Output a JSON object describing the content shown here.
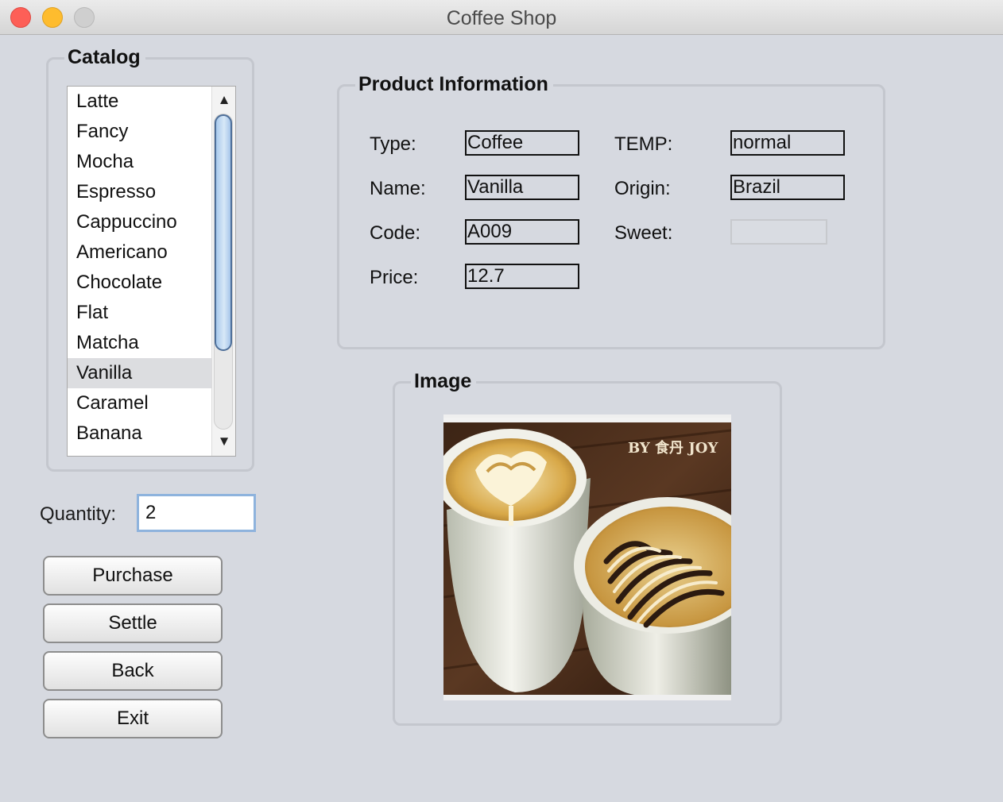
{
  "window": {
    "title": "Coffee Shop"
  },
  "catalog": {
    "title": "Catalog",
    "items": [
      "Latte",
      "Fancy",
      "Mocha",
      "Espresso",
      "Cappuccino",
      "Americano",
      "Chocolate",
      "Flat",
      "Matcha",
      "Vanilla",
      "Caramel",
      "Banana"
    ],
    "selected": "Vanilla",
    "scroll": {
      "up_glyph": "▲",
      "down_glyph": "▼"
    }
  },
  "quantity": {
    "label": "Quantity:",
    "value": "2"
  },
  "buttons": {
    "purchase": "Purchase",
    "settle": "Settle",
    "back": "Back",
    "exit": "Exit"
  },
  "product": {
    "title": "Product Information",
    "type_label": "Type:",
    "type_value": "Coffee",
    "name_label": "Name:",
    "name_value": "Vanilla",
    "code_label": "Code:",
    "code_value": "A009",
    "price_label": "Price:",
    "price_value": "12.7",
    "temp_label": "TEMP:",
    "temp_value": "normal",
    "origin_label": "Origin:",
    "origin_value": "Brazil",
    "sweet_label": "Sweet:",
    "sweet_value": ""
  },
  "image": {
    "title": "Image",
    "watermark": "BY 食丹 JOY"
  },
  "colors": {
    "window_bg": "#d6d9e0",
    "scroll_thumb": "#a8c9ec",
    "focus_border": "#8eb3dd",
    "selected_row": "#dcdde0"
  }
}
